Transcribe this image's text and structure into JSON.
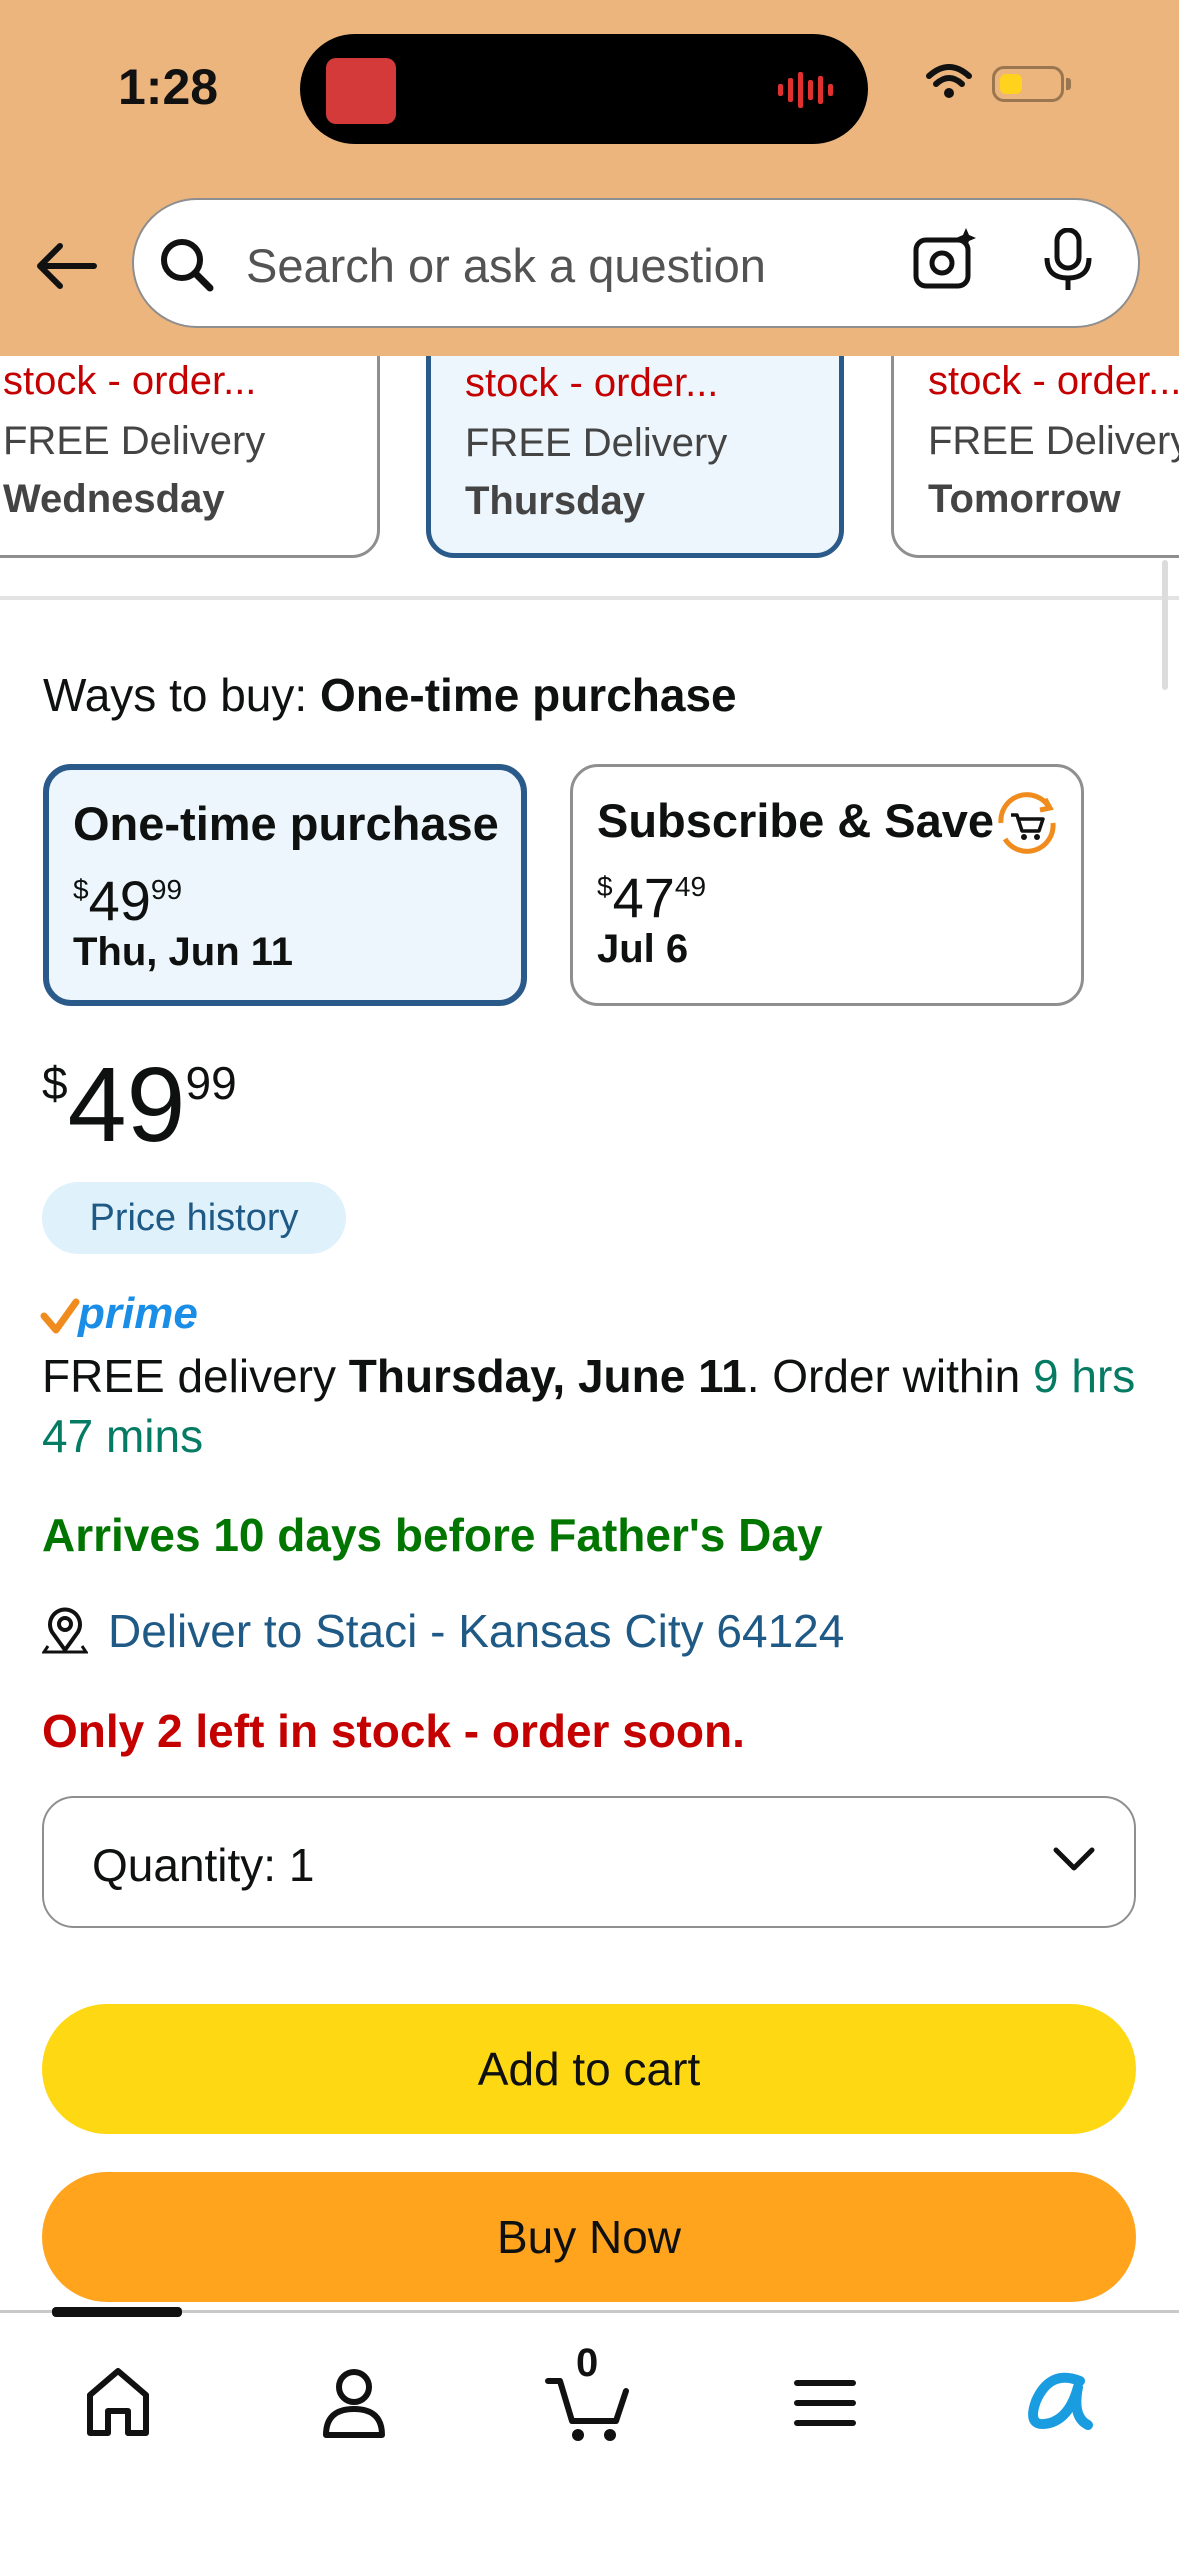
{
  "status_bar": {
    "time": "1:28"
  },
  "search": {
    "placeholder": "Search or ask a question"
  },
  "delivery_options": [
    {
      "stock": "stock - order...",
      "delivery": "FREE Delivery",
      "day": "Wednesday",
      "selected": false
    },
    {
      "stock": "stock - order...",
      "delivery": "FREE Delivery",
      "day": "Thursday",
      "selected": true
    },
    {
      "stock": "stock - order...",
      "delivery": "FREE Delivery",
      "day": "Tomorrow",
      "selected": false
    }
  ],
  "ways_to_buy": {
    "label": "Ways to buy:",
    "selected": "One-time purchase",
    "options": [
      {
        "title": "One-time purchase",
        "currency": "$",
        "dollars": "49",
        "cents": "99",
        "date": "Thu, Jun 11"
      },
      {
        "title": "Subscribe & Save",
        "currency": "$",
        "dollars": "47",
        "cents": "49",
        "date": "Jul 6"
      }
    ]
  },
  "price": {
    "currency": "$",
    "dollars": "49",
    "cents": "99"
  },
  "price_history_label": "Price history",
  "prime_label": "prime",
  "delivery": {
    "prefix": "FREE delivery ",
    "date": "Thursday, June 11",
    "mid": ". Order within ",
    "countdown": "9 hrs 47 mins"
  },
  "arrives_text": "Arrives 10 days before Father's Day",
  "deliver_to": "Deliver to Staci - Kansas City 64124",
  "stock_text": "Only 2 left in stock - order soon.",
  "quantity": {
    "label": "Quantity:",
    "value": "1"
  },
  "buttons": {
    "add_to_cart": "Add to cart",
    "buy_now": "Buy Now"
  },
  "tabbar": {
    "cart_count": "0"
  },
  "colors": {
    "header_bg": "#ecb57e",
    "selected_border": "#2a5a8a",
    "add_to_cart": "#ffd814",
    "buy_now": "#ffa41c",
    "stock_red": "#c40000",
    "arrives_green": "#007600",
    "link_blue": "#1f5a86"
  }
}
